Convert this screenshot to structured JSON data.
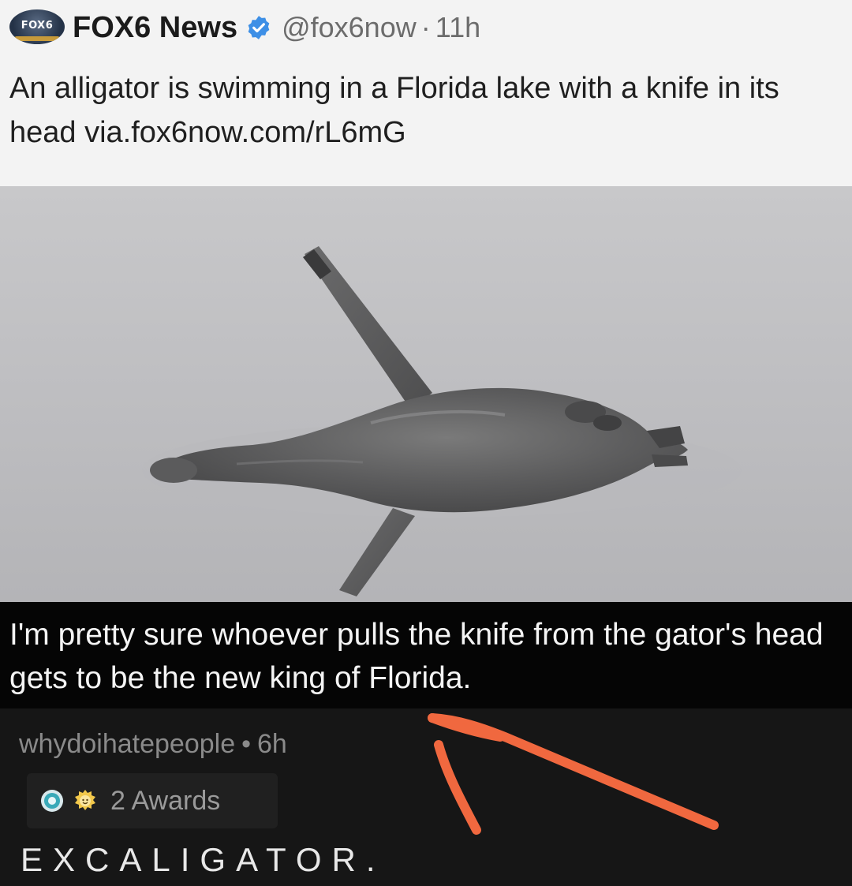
{
  "tweet": {
    "account_name": "FOX6 News",
    "handle": "@fox6now",
    "separator": "·",
    "time": "11h",
    "text": "An alligator is swimming in a Florida lake with a knife in its head via.fox6now.com/rL6mG",
    "avatar_label": "FOX6"
  },
  "photo": {
    "subject": "alligator-with-knife"
  },
  "caption": {
    "text": "I'm pretty sure whoever pulls the knife from the gator's head gets to be the new king of Florida."
  },
  "comment": {
    "username": "whydoihatepeople",
    "separator": "•",
    "time": "6h",
    "awards": "2 Awards",
    "text": "EXCALIGATOR."
  },
  "colors": {
    "arrow": "#f0683f",
    "verified": "#3d8fe6",
    "caption_bg": "#050505",
    "comment_bg": "#161616",
    "tweet_bg": "#f3f3f3"
  }
}
